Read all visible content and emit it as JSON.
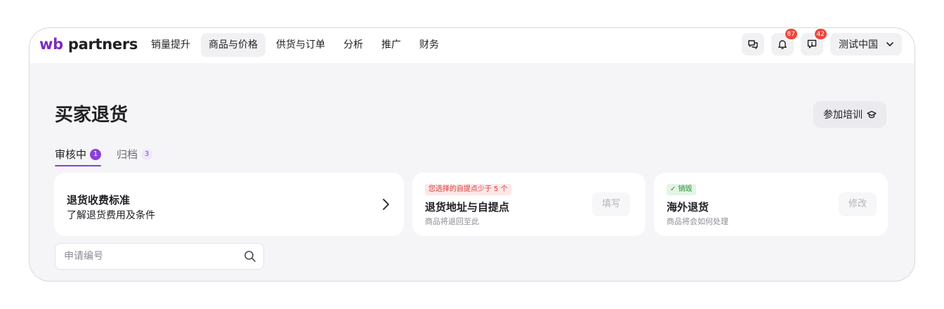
{
  "brand": {
    "prefix": "wb",
    "name": "partners",
    "accent": "#7b2cbf"
  },
  "nav": {
    "items": [
      {
        "label": "销量提升",
        "active": false
      },
      {
        "label": "商品与价格",
        "active": true
      },
      {
        "label": "供货与订单",
        "active": false
      },
      {
        "label": "分析",
        "active": false
      },
      {
        "label": "推广",
        "active": false
      },
      {
        "label": "财务",
        "active": false
      }
    ]
  },
  "tools": {
    "chat_icon": "chat-bubbles-icon",
    "notifications_count": "87",
    "support_count": "42",
    "account_label": "测试中国"
  },
  "page": {
    "title": "买家退货",
    "training_button": "参加培训"
  },
  "tabs": [
    {
      "label": "审核中",
      "count": "1",
      "active": true
    },
    {
      "label": "归档",
      "count": "3",
      "active": false
    }
  ],
  "cards": {
    "fee": {
      "title": "退货收费标准",
      "subtitle": "了解退货费用及条件"
    },
    "address": {
      "tag": "您选择的自提点少于 5 个",
      "title": "退货地址与自提点",
      "subtitle": "商品将退回至此",
      "action": "填写"
    },
    "oversea": {
      "tag": "✓ 销毁",
      "title": "海外退货",
      "subtitle": "商品将会如何处理",
      "action": "修改"
    }
  },
  "search": {
    "placeholder": "申请编号",
    "value": ""
  },
  "colors": {
    "accent": "#8b3fd9",
    "badge": "#f0443a",
    "warn": "#d93a3a",
    "ok": "#2c8a3a"
  }
}
